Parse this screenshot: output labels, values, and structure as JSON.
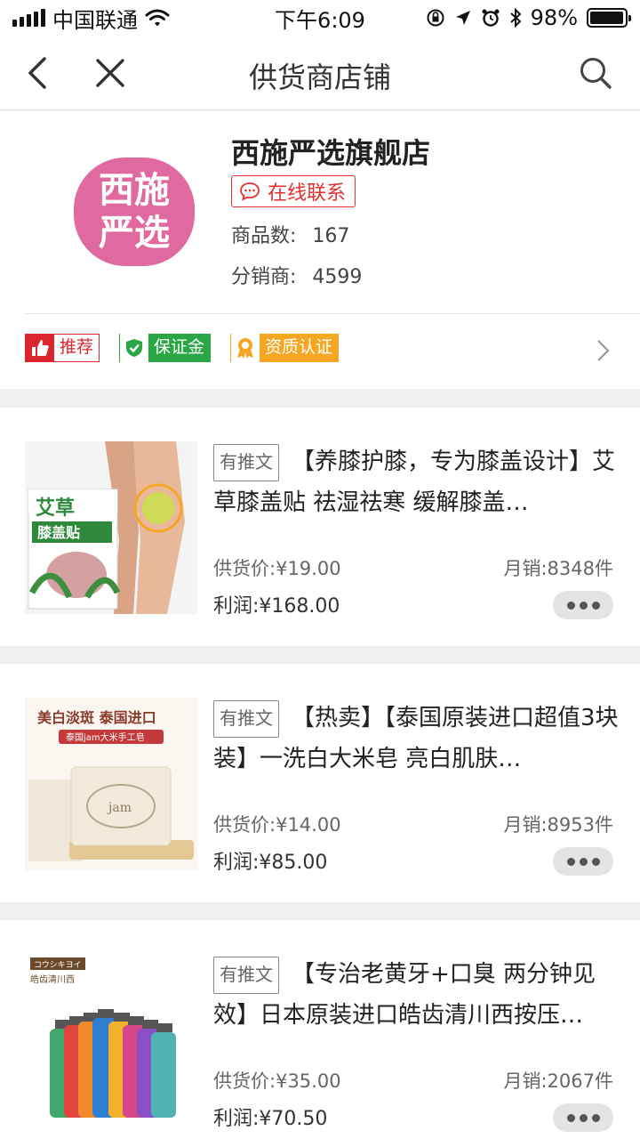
{
  "status_bar": {
    "carrier": "中国联通",
    "time": "下午6:09",
    "battery": "98%",
    "battery_level": 0.98
  },
  "nav": {
    "title": "供货商店铺",
    "icons": [
      "back-arrow-icon",
      "close-icon",
      "search-icon"
    ]
  },
  "shop": {
    "logo_text": [
      "西施",
      "严选"
    ],
    "name": "西施严选旗舰店",
    "contact_label": "在线联系",
    "goods_label": "商品数:",
    "goods_count": "167",
    "distributors_label": "分销商:",
    "distributors_count": "4599",
    "badges": [
      {
        "label": "推荐",
        "color": "#d9262f",
        "icon": "thumbs-up-icon"
      },
      {
        "label": "保证金",
        "color": "#2aa745",
        "icon": "shield-check-icon"
      },
      {
        "label": "资质认证",
        "color": "#f5a623",
        "icon": "certificate-icon"
      }
    ]
  },
  "products": [
    {
      "tag": "有推文",
      "title": "【养膝护膝，专为膝盖设计】艾草膝盖贴 祛湿祛寒 缓解膝盖…",
      "supply_price_label": "供货价:",
      "supply_price": "¥19.00",
      "monthly_sales_label": "月销:",
      "monthly_sales": "8348件",
      "profit_label": "利润:",
      "profit": "¥168.00",
      "image_text": [
        "艾草",
        "膝盖贴"
      ]
    },
    {
      "tag": "有推文",
      "title": "【热卖】【泰国原装进口超值3块装】一洗白大米皂 亮白肌肤…",
      "supply_price_label": "供货价:",
      "supply_price": "¥14.00",
      "monthly_sales_label": "月销:",
      "monthly_sales": "8953件",
      "profit_label": "利润:",
      "profit": "¥85.00",
      "image_text": [
        "美白淡斑 泰国进口",
        "泰国jam大米手工皂",
        "jam"
      ]
    },
    {
      "tag": "有推文",
      "title": "【专治老黄牙+口臭 两分钟见效】日本原装进口皓齿清川西按压…",
      "supply_price_label": "供货价:",
      "supply_price": "¥35.00",
      "monthly_sales_label": "月销:",
      "monthly_sales": "2067件",
      "profit_label": "利润:",
      "profit": "¥70.50",
      "image_text": [
        "コウシキヨイ",
        "皓齿清川西"
      ]
    }
  ]
}
